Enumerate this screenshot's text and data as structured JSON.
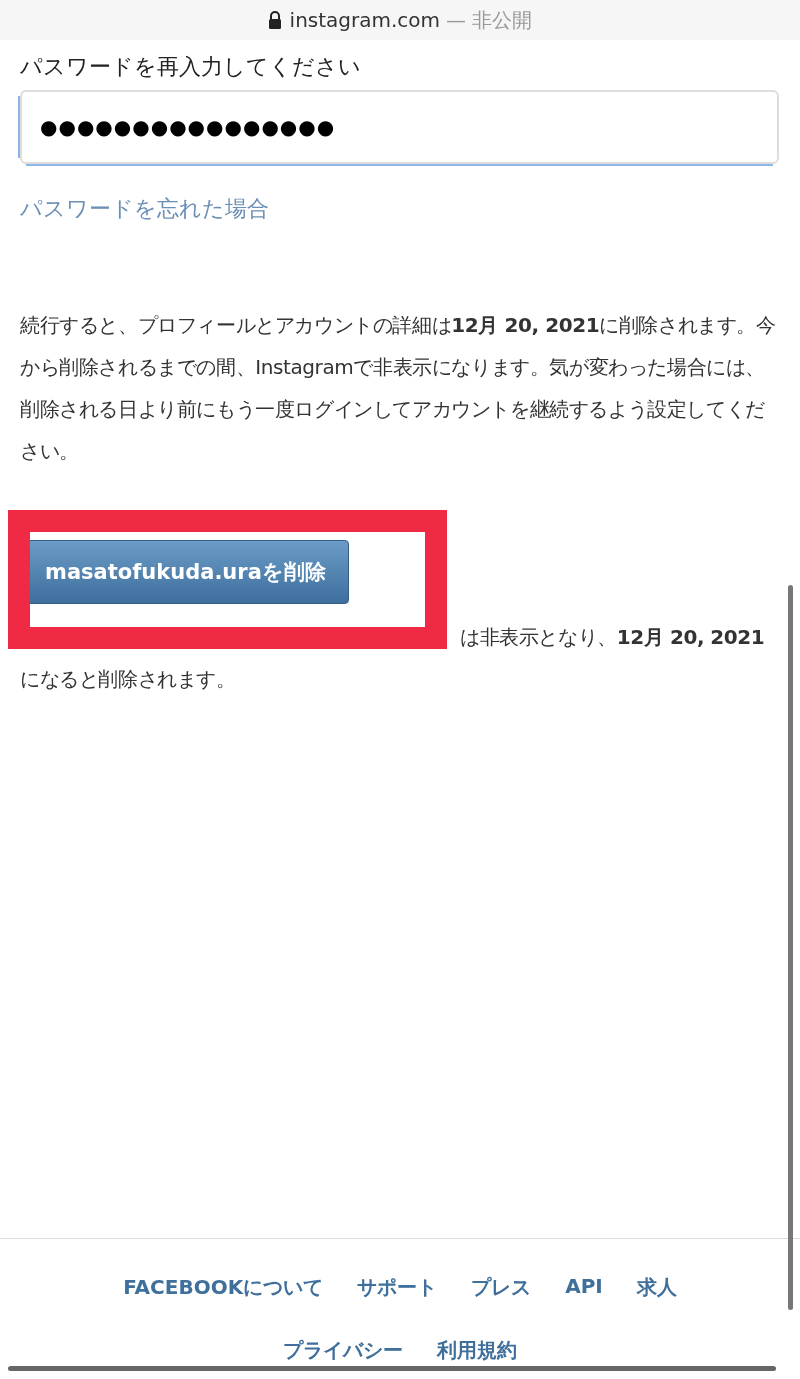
{
  "address_bar": {
    "domain": "instagram.com",
    "status": "— 非公開"
  },
  "password_field": {
    "label": "パスワードを再入力してください",
    "value": "●●●●●●●●●●●●●●●●",
    "focused": true
  },
  "forgot_link": "パスワードを忘れた場合",
  "notice": "続行すると、プロフィールとアカウントの詳細は**12月 20, 2021**に削除されます。今から削除されるまでの間、Instagramで非表示になります。気が変わった場合には、削除される日より前にもう一度ログインしてアカウントを継続するよう設定してください。",
  "delete_button": {
    "label": "masatofukuda.uraを削除",
    "highlighted": true
  },
  "after_note": "は非表示となり、**12月 20,** **2021**になると削除されます。",
  "footer": {
    "main_links": [
      "FACEBOOKについて",
      "サポート",
      "プレス",
      "API",
      "求人"
    ],
    "legal_links": [
      "プライバシー",
      "利用規約"
    ]
  }
}
